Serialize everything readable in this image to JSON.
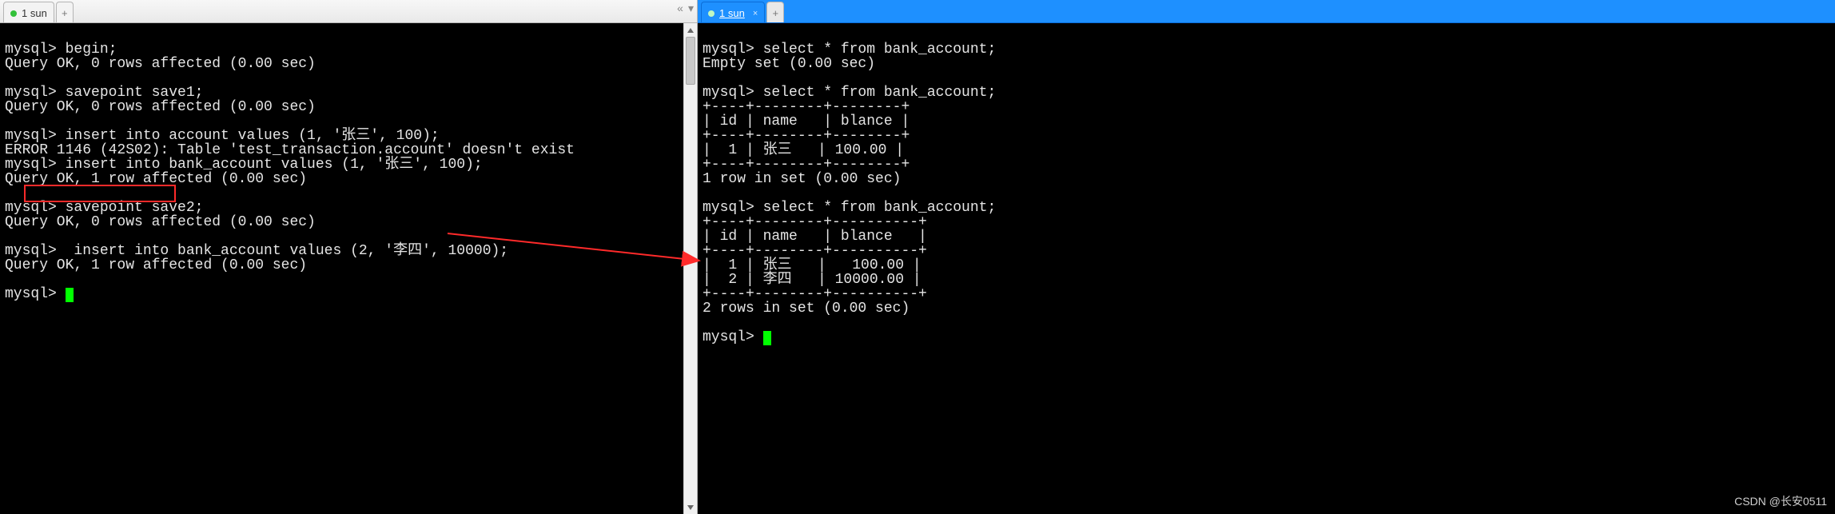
{
  "left": {
    "tab_label": "1 sun",
    "lines": [
      "mysql> begin;",
      "Query OK, 0 rows affected (0.00 sec)",
      "",
      "mysql> savepoint save1;",
      "Query OK, 0 rows affected (0.00 sec)",
      "",
      "mysql> insert into account values (1, '张三', 100);",
      "ERROR 1146 (42S02): Table 'test_transaction.account' doesn't exist",
      "mysql> insert into bank_account values (1, '张三', 100);",
      "Query OK, 1 row affected (0.00 sec)",
      "",
      "mysql> savepoint save2;",
      "Query OK, 0 rows affected (0.00 sec)",
      "",
      "mysql>  insert into bank_account values (2, '李四', 10000);",
      "Query OK, 1 row affected (0.00 sec)",
      "",
      "mysql> "
    ]
  },
  "right": {
    "tab_label": "1 sun",
    "lines": [
      "mysql> select * from bank_account;",
      "Empty set (0.00 sec)",
      "",
      "mysql> select * from bank_account;",
      "+----+--------+--------+",
      "| id | name   | blance |",
      "+----+--------+--------+",
      "|  1 | 张三   | 100.00 |",
      "+----+--------+--------+",
      "1 row in set (0.00 sec)",
      "",
      "mysql> select * from bank_account;",
      "+----+--------+----------+",
      "| id | name   | blance   |",
      "+----+--------+----------+",
      "|  1 | 张三   |   100.00 |",
      "|  2 | 李四   | 10000.00 |",
      "+----+--------+----------+",
      "2 rows in set (0.00 sec)",
      "",
      "mysql> "
    ]
  },
  "watermark": "CSDN @长安0511",
  "annotations": {
    "highlighted_command": "savepoint save2;",
    "arrow_points_to_row": {
      "id": 2,
      "name": "李四",
      "blance": 10000.0
    }
  },
  "chart_data": null
}
